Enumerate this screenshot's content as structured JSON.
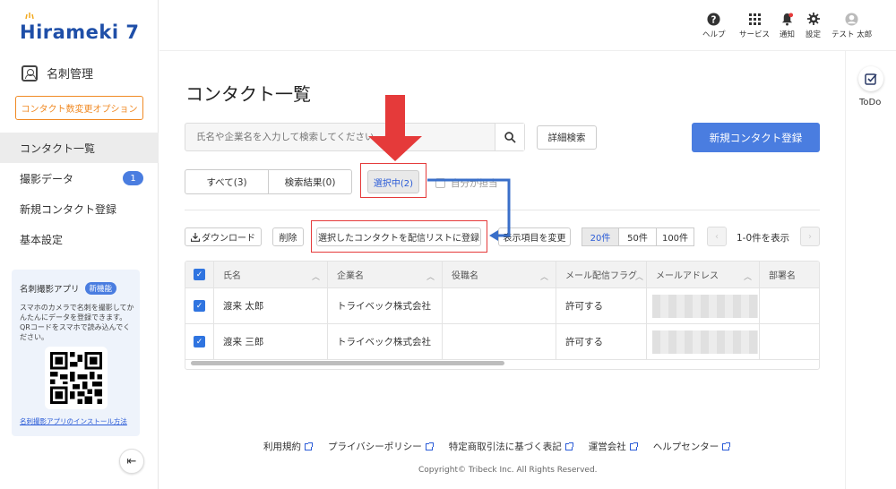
{
  "app": {
    "logo_text": "irameki 7",
    "logo_h": "H"
  },
  "header": {
    "items": [
      {
        "label": "ヘルプ",
        "icon": "help-icon"
      },
      {
        "label": "サービス",
        "icon": "grid-icon"
      },
      {
        "label": "通知",
        "icon": "bell-icon"
      },
      {
        "label": "設定",
        "icon": "gear-icon"
      },
      {
        "label": "テスト 太郎",
        "icon": "user-icon"
      }
    ]
  },
  "sidebar": {
    "section_title": "名刺管理",
    "option_button": "コンタクト数変更オプション",
    "items": [
      {
        "label": "コンタクト一覧",
        "active": true
      },
      {
        "label": "撮影データ",
        "badge": "1"
      },
      {
        "label": "新規コンタクト登録"
      },
      {
        "label": "基本設定"
      }
    ],
    "promo": {
      "title": "名刺撮影アプリ",
      "badge": "新機能",
      "text": "スマホのカメラで名刺を撮影してかんたんにデータを登録できます。QRコードをスマホで読み込んでください。",
      "link": "名刺撮影アプリのインストール方法"
    },
    "collapse_icon": "⇤"
  },
  "main": {
    "title": "コンタクト一覧",
    "search_placeholder": "氏名や企業名を入力して検索してください",
    "advanced_search": "詳細検索",
    "new_contact": "新規コンタクト登録",
    "tabs": {
      "all": "すべて(3)",
      "results": "検索結果(0)",
      "selected": "選択中(2)"
    },
    "mine_label": "自分が担当",
    "toolbar": {
      "download": "ダウンロード",
      "delete": "削除",
      "register_list": "選択したコンタクトを配信リストに登録",
      "change_columns": "表示項目を変更"
    },
    "page_sizes": [
      "20件",
      "50件",
      "100件"
    ],
    "range_text": "1-0件を表示",
    "table": {
      "columns": [
        "氏名",
        "企業名",
        "役職名",
        "メール配信フラグ",
        "メールアドレス",
        "部署名"
      ],
      "rows": [
        {
          "name": "渡来 太郎",
          "company": "トライベック株式会社",
          "title": "",
          "mail_flag": "許可する"
        },
        {
          "name": "渡来 三郎",
          "company": "トライベック株式会社",
          "title": "",
          "mail_flag": "許可する"
        }
      ]
    }
  },
  "footer": {
    "links": [
      "利用規約",
      "プライバシーポリシー",
      "特定商取引法に基づく表記",
      "運営会社",
      "ヘルプセンター"
    ],
    "copyright": "Copyright© Tribeck Inc. All Rights Reserved."
  },
  "right_panel": {
    "todo_label": "ToDo"
  },
  "colors": {
    "primary": "#4a7de0",
    "accent_orange": "#f08a24",
    "annotation_red": "#e53a3a",
    "annotation_blue": "#3a6fc9"
  }
}
